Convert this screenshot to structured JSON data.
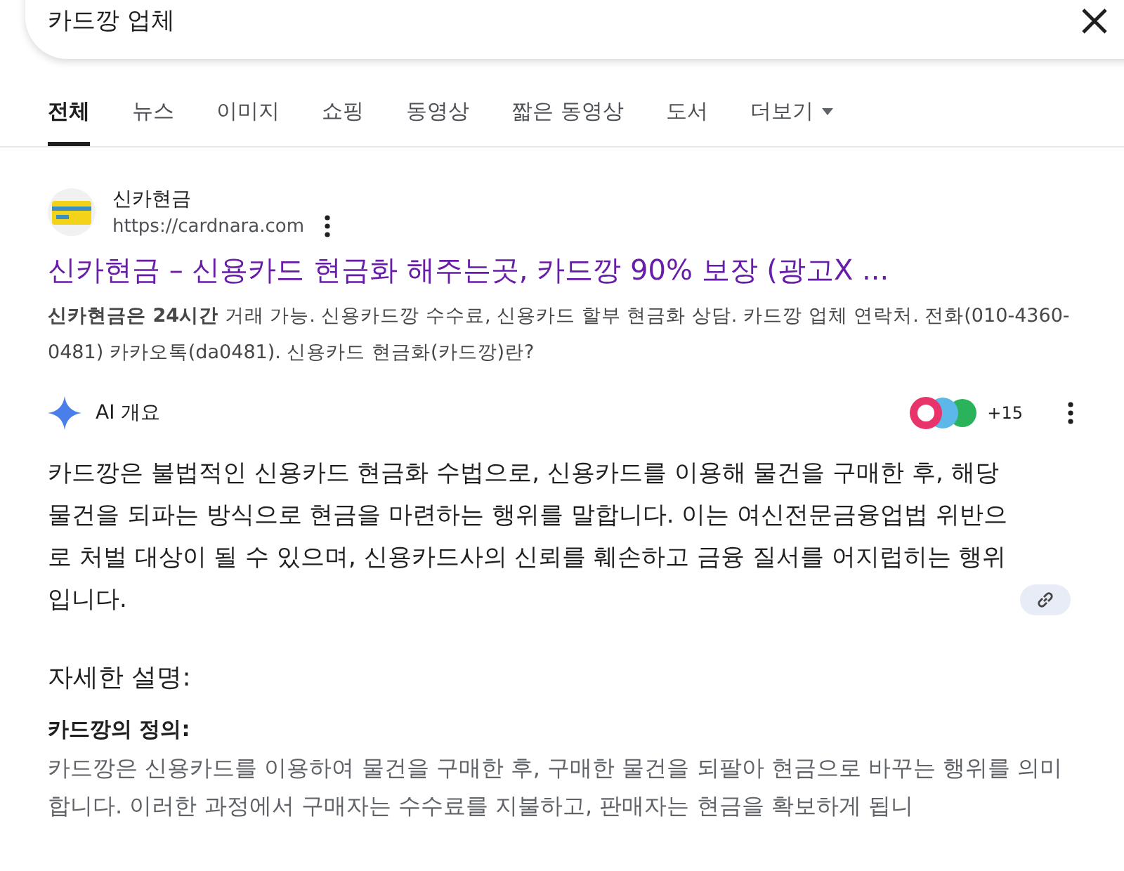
{
  "search": {
    "value": "카드깡 업체"
  },
  "tabs": [
    {
      "label": "전체",
      "selected": true
    },
    {
      "label": "뉴스",
      "selected": false
    },
    {
      "label": "이미지",
      "selected": false
    },
    {
      "label": "쇼핑",
      "selected": false
    },
    {
      "label": "동영상",
      "selected": false
    },
    {
      "label": "짧은 동영상",
      "selected": false
    },
    {
      "label": "도서",
      "selected": false
    },
    {
      "label": "더보기",
      "selected": false,
      "kind": "menu"
    }
  ],
  "result": {
    "site_name": "신카현금",
    "url": "https://cardnara.com",
    "title": "신카현금 – 신용카드 현금화 해주는곳, 카드깡 90% 보장 (광고X ...",
    "snippet": "**신카현금은 24시간** 거래 가능. 신용카드깡 수수료, 신용카드 할부 현금화 상담. 카드깡 업체 연락처. 전화(010-4360-0481) 카카오톡(da0481). 신용카드 현금화(카드깡)란?"
  },
  "ai_overview": {
    "label": "AI 개요",
    "source_count": "+15",
    "summary": "카드깡은 불법적인 신용카드 현금화 수법으로, 신용카드를 이용해 물건을 구매한 후, 해당 물건을 되파는 방식으로 현금을 마련하는 행위를 말합니다. 이는 여신전문금융업법 위반으로 처벌 대상이 될 수 있으며, 신용카드사의 신뢰를 훼손하고 금융 질서를 어지럽히는 행위입니다.",
    "heading": "자세한 설명:",
    "subheading": "카드깡의 정의:",
    "detail": "카드깡은 신용카드를 이용하여 물건을 구매한 후, 구매한 물건을 되팔아 현금으로 바꾸는 행위를 의미합니다. 이러한 과정에서 구매자는 수수료를 지불하고, 판매자는 현금을 확보하게 됩니"
  }
}
